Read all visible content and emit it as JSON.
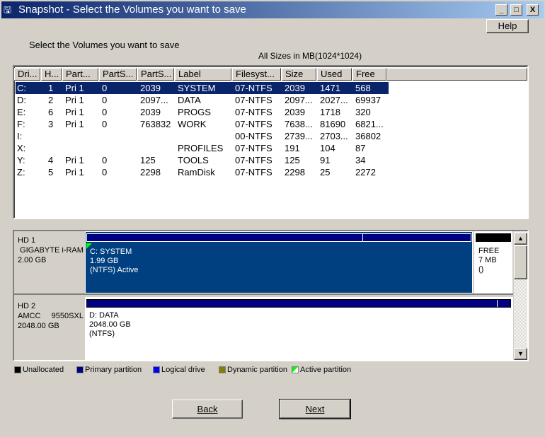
{
  "window": {
    "title": "Snapshot - Select the Volumes you want to save",
    "minimize": "_",
    "maximize": "□",
    "close": "X"
  },
  "help_label": "Help",
  "instruction": "Select the Volumes you want to save",
  "sizes_note": "All Sizes in MB(1024*1024)",
  "columns": [
    "Dri...",
    "H...",
    "Part...",
    "PartS...",
    "PartS...",
    "Label",
    "Filesyst...",
    "Size",
    "Used",
    "Free"
  ],
  "rows": [
    [
      "C:",
      "1",
      "Pri 1",
      "0",
      "2039",
      "SYSTEM",
      "07-NTFS",
      "2039",
      "1471",
      "568"
    ],
    [
      "D:",
      "2",
      "Pri 1",
      "0",
      "2097...",
      "DATA",
      "07-NTFS",
      "2097...",
      "2027...",
      "69937"
    ],
    [
      "E:",
      "6",
      "Pri 1",
      "0",
      "2039",
      "PROGS",
      "07-NTFS",
      "2039",
      "1718",
      "320"
    ],
    [
      "F:",
      "3",
      "Pri 1",
      "0",
      "763832",
      "WORK",
      "07-NTFS",
      "7638...",
      "81690",
      "6821..."
    ],
    [
      "I:",
      "",
      "",
      "",
      "",
      "",
      "00-NTFS",
      "2739...",
      "2703...",
      "36802"
    ],
    [
      "X:",
      "",
      "",
      "",
      "",
      "PROFILES",
      "07-NTFS",
      "191",
      "104",
      "87"
    ],
    [
      "Y:",
      "4",
      "Pri 1",
      "0",
      "125",
      "TOOLS",
      "07-NTFS",
      "125",
      "91",
      "34"
    ],
    [
      "Z:",
      "5",
      "Pri 1",
      "0",
      "2298",
      "RamDisk",
      "07-NTFS",
      "2298",
      "25",
      "2272"
    ]
  ],
  "selected_row": 0,
  "disks": [
    {
      "name": "HD 1",
      "model": " GIGABYTE i-RAM",
      "size": "2.00 GB",
      "partition": {
        "line1": "C: SYSTEM",
        "line2": "1.99 GB",
        "line3": "(NTFS) Active",
        "used_fraction": 0.72
      },
      "free": {
        "line1": "FREE",
        "line2": "7 MB",
        "line3": "()"
      }
    },
    {
      "name": "HD 2",
      "model": "AMCC     9550SXL",
      "size": "2048.00 GB",
      "partition": {
        "line1": "D: DATA",
        "line2": "2048.00 GB",
        "line3": "(NTFS)",
        "used_fraction": 0.97
      }
    }
  ],
  "legend": [
    {
      "label": "Unallocated",
      "color": "#000000"
    },
    {
      "label": "Primary partition",
      "color": "#000080"
    },
    {
      "label": "Logical drive",
      "color": "#0000ff"
    },
    {
      "label": "Dynamic partition",
      "color": "#808000"
    },
    {
      "label": "Active partition",
      "color": "#00ff00"
    }
  ],
  "buttons": {
    "back": "Back",
    "next": "Next"
  }
}
